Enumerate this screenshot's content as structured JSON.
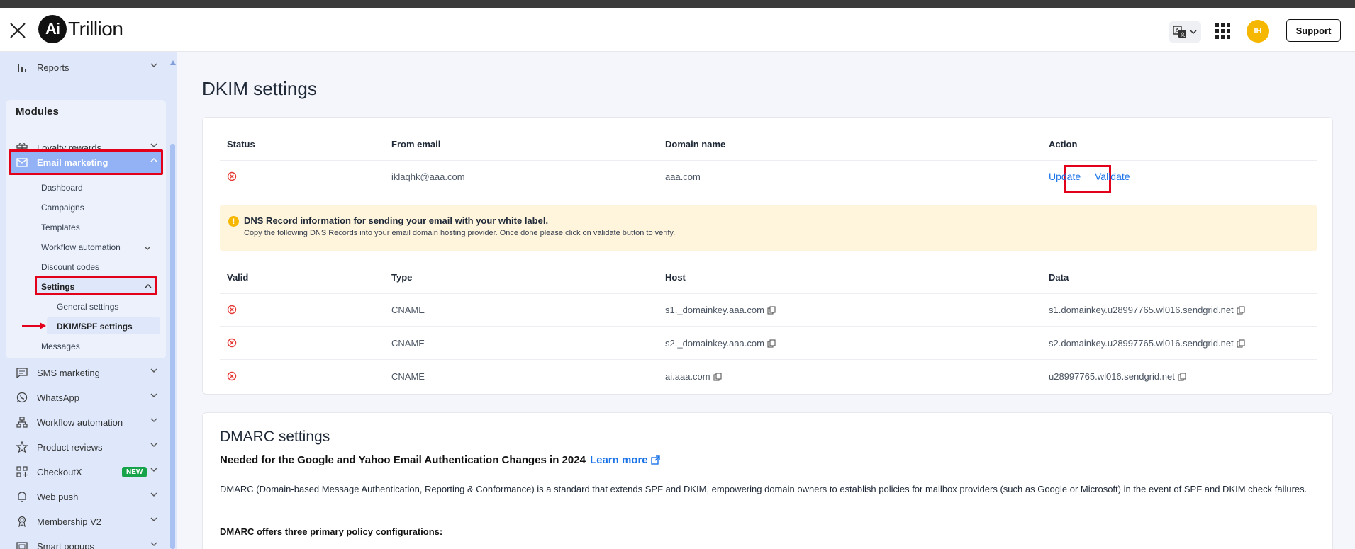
{
  "app": {
    "logo_mark": "Ai",
    "logo_text": "Trillion",
    "avatar_initials": "IH",
    "support_label": "Support"
  },
  "sidebar": {
    "reports": "Reports",
    "modules_title": "Modules",
    "loyalty": "Loyalty rewards",
    "email_marketing": "Email marketing",
    "email_sub": {
      "dashboard": "Dashboard",
      "campaigns": "Campaigns",
      "templates": "Templates",
      "workflow": "Workflow automation",
      "discount": "Discount codes",
      "settings": "Settings",
      "general_settings": "General settings",
      "dkim_spf": "DKIM/SPF settings",
      "messages": "Messages"
    },
    "sms": "SMS marketing",
    "whatsapp": "WhatsApp",
    "workflow": "Workflow automation",
    "product_reviews": "Product reviews",
    "checkoutx": "CheckoutX",
    "new_badge": "NEW",
    "web_push": "Web push",
    "membership": "Membership V2",
    "smart_popups": "Smart popups"
  },
  "dkim": {
    "title": "DKIM settings",
    "headers": {
      "status": "Status",
      "from_email": "From email",
      "domain_name": "Domain name",
      "action": "Action"
    },
    "row": {
      "from_email": "iklaqhk@aaa.com",
      "domain_name": "aaa.com",
      "update": "Update",
      "validate": "Validate"
    },
    "alert_title": "DNS Record information for sending your email with your white label.",
    "alert_body": "Copy the following DNS Records into your email domain hosting provider. Once done please click on validate button to verify.",
    "dns_headers": {
      "valid": "Valid",
      "type": "Type",
      "host": "Host",
      "data": "Data"
    },
    "dns_rows": [
      {
        "type": "CNAME",
        "host": "s1._domainkey.aaa.com",
        "data": "s1.domainkey.u28997765.wl016.sendgrid.net"
      },
      {
        "type": "CNAME",
        "host": "s2._domainkey.aaa.com",
        "data": "s2.domainkey.u28997765.wl016.sendgrid.net"
      },
      {
        "type": "CNAME",
        "host": "ai.aaa.com",
        "data": "u28997765.wl016.sendgrid.net"
      }
    ]
  },
  "dmarc": {
    "title": "DMARC settings",
    "subtitle": "Needed for the Google and Yahoo Email Authentication Changes in 2024",
    "learn_more": "Learn more",
    "description": "DMARC (Domain-based Message Authentication, Reporting & Conformance) is a standard that extends SPF and DKIM, empowering domain owners to establish policies for mailbox providers (such as Google or Microsoft) in the event of SPF and DKIM check failures.",
    "offers_title": "DMARC offers three primary policy configurations:"
  },
  "colors": {
    "accent": "#1a73e8",
    "highlight": "#e3001b",
    "error": "#e53935",
    "active_nav": "#93b2f5"
  }
}
